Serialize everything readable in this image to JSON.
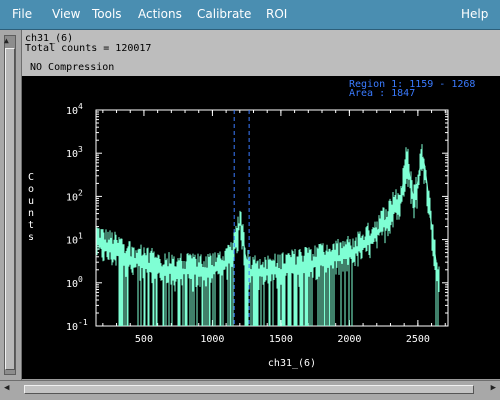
{
  "menu": {
    "items": [
      "File",
      "View",
      "Tools",
      "Actions",
      "Calibrate",
      "ROI"
    ],
    "help": "Help"
  },
  "info": {
    "name": "ch31_(6)",
    "total_counts": "Total counts = 120017",
    "compression": "NO Compression"
  },
  "region": {
    "line1": "Region 1: 1159 - 1268",
    "line2": "Area : 1847"
  },
  "colors": {
    "menubar": "#4a8eb1",
    "plot_bg": "#000000",
    "spectrum": "#7fffd4",
    "region_markers": "#3a7bff"
  },
  "icons": {
    "scroll_up": "▲",
    "scroll_left": "◀",
    "scroll_right": "▶"
  },
  "chart_data": {
    "type": "line",
    "title": "",
    "xlabel": "ch31_(6)",
    "ylabel": "Counts",
    "y_scale": "log",
    "xlim": [
      150,
      2720
    ],
    "ylim": [
      0.1,
      10000
    ],
    "x_ticks": [
      500,
      1000,
      1500,
      2000,
      2500
    ],
    "y_ticks": [
      {
        "value": 0.1,
        "base": "10",
        "exp": "-1"
      },
      {
        "value": 1,
        "base": "10",
        "exp": "0"
      },
      {
        "value": 10,
        "base": "10",
        "exp": "1"
      },
      {
        "value": 100,
        "base": "10",
        "exp": "2"
      },
      {
        "value": 1000,
        "base": "10",
        "exp": "3"
      },
      {
        "value": 10000,
        "base": "10",
        "exp": "4"
      }
    ],
    "region_markers": [
      1159,
      1268
    ],
    "series": [
      {
        "x": [
          150,
          200,
          300,
          400,
          500,
          600,
          700,
          800,
          900,
          1000,
          1050,
          1100,
          1150,
          1180,
          1200,
          1220,
          1240,
          1270,
          1300,
          1400,
          1500,
          1600,
          1700,
          1800,
          1900,
          2000,
          2100,
          2200,
          2250,
          2300,
          2330,
          2360,
          2380,
          2400,
          2420,
          2440,
          2460,
          2480,
          2500,
          2520,
          2540,
          2560,
          2580,
          2600,
          2620,
          2640,
          2660
        ],
        "values": [
          10,
          8,
          6,
          4,
          3,
          2.5,
          2,
          2,
          2,
          2.2,
          2.5,
          3,
          5,
          12,
          30,
          15,
          4,
          2,
          2,
          2,
          2,
          2.5,
          3,
          3.5,
          4,
          5,
          8,
          15,
          25,
          40,
          80,
          60,
          100,
          300,
          800,
          300,
          100,
          100,
          200,
          600,
          800,
          300,
          80,
          20,
          6,
          2,
          1
        ]
      }
    ]
  }
}
